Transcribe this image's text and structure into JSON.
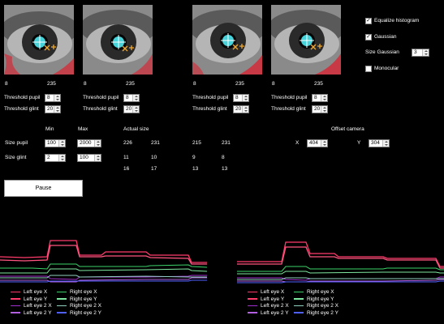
{
  "eye_views": [
    {
      "name": "eye-view-1"
    },
    {
      "name": "eye-view-2"
    },
    {
      "name": "eye-view-3"
    },
    {
      "name": "eye-view-4"
    }
  ],
  "options": {
    "equalize_label": "Equalize histogram",
    "equalize_checked": true,
    "gaussian_label": "Gaussian",
    "gaussian_checked": true,
    "size_gaussian_label": "Size Gaussian",
    "size_gaussian_value": "3",
    "monocular_label": "Monocular",
    "monocular_checked": false
  },
  "panels": [
    {
      "hist_low": "8",
      "hist_high": "235",
      "threshold_pupil_label": "Threshold pupil",
      "threshold_pupil": "8",
      "threshold_glint_label": "Threshold glint",
      "threshold_glint": "20"
    },
    {
      "hist_low": "8",
      "hist_high": "235",
      "threshold_pupil_label": "Threshold pupil",
      "threshold_pupil": "8",
      "threshold_glint_label": "Threshold glint",
      "threshold_glint": "20"
    },
    {
      "hist_low": "8",
      "hist_high": "235",
      "threshold_pupil_label": "Threshold pupil",
      "threshold_pupil": "8",
      "threshold_glint_label": "Threshold glint",
      "threshold_glint": "20"
    },
    {
      "hist_low": "8",
      "hist_high": "235",
      "threshold_pupil_label": "Threshold pupil",
      "threshold_pupil": "8",
      "threshold_glint_label": "Threshold glint",
      "threshold_glint": "20"
    }
  ],
  "sizes": {
    "min_header": "Min",
    "max_header": "Max",
    "actual_header": "Actual size",
    "size_pupil_label": "Size pupil",
    "size_pupil_min": "100",
    "size_pupil_max": "2000",
    "size_glint_label": "Size glint",
    "size_glint_min": "2",
    "size_glint_max": "100",
    "actual": [
      [
        "226",
        "231",
        "215",
        "231"
      ],
      [
        "11",
        "10",
        "9",
        "8"
      ],
      [
        "16",
        "17",
        "13",
        "13"
      ]
    ]
  },
  "offset": {
    "title": "Offset camera",
    "x_label": "X",
    "x_value": "404",
    "y_label": "Y",
    "y_value": "304"
  },
  "pause_button": "Pause",
  "legend": [
    {
      "label": "Left eye X",
      "color": "#ff3b6b"
    },
    {
      "label": "Right eye X",
      "color": "#3cd46a"
    },
    {
      "label": "Left eye Y",
      "color": "#ff3b6b"
    },
    {
      "label": "Right eye Y",
      "color": "#7fe8a0"
    },
    {
      "label": "Left eye 2 X",
      "color": "#a22fd0"
    },
    {
      "label": "Right eye 2 X",
      "color": "#8fd0c0"
    },
    {
      "label": "Left eye 2 Y",
      "color": "#b25fe0"
    },
    {
      "label": "Right eye 2 Y",
      "color": "#5060ff"
    }
  ],
  "colors": {
    "background": "#000000",
    "pupil_marker": "#4fe8f0",
    "glint_marker": "#f0a830",
    "threshold_overlay": "#ff1020"
  }
}
